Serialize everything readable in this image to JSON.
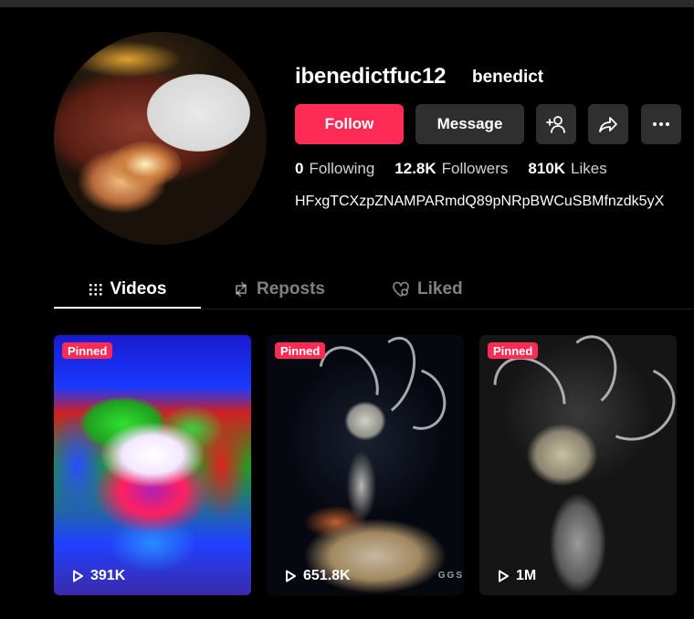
{
  "profile": {
    "username": "ibenedictfuc12",
    "nickname": "benedict",
    "bio": "HFxgTCXzpZNAMPARmdQ89pNRpBWCuSBMfnzdk5yX",
    "stats": [
      {
        "value": "0",
        "label": "Following"
      },
      {
        "value": "12.8K",
        "label": "Followers"
      },
      {
        "value": "810K",
        "label": "Likes"
      }
    ]
  },
  "actions": {
    "follow_label": "Follow",
    "message_label": "Message",
    "add_friend_icon": "add-friend-icon",
    "share_icon": "share-icon",
    "more_icon": "more-icon"
  },
  "tabs": [
    {
      "label": "Videos",
      "icon": "grid-icon",
      "active": true
    },
    {
      "label": "Reposts",
      "icon": "repost-icon",
      "active": false
    },
    {
      "label": "Liked",
      "icon": "heart-icon",
      "active": false
    }
  ],
  "videos": [
    {
      "badge": "Pinned",
      "views": "391K"
    },
    {
      "badge": "Pinned",
      "views": "651.8K",
      "watermark": "GGS"
    },
    {
      "badge": "Pinned",
      "views": "1M"
    }
  ],
  "colors": {
    "accent": "#fe2c55",
    "background": "#000000",
    "button_secondary": "#2f2f2f"
  }
}
